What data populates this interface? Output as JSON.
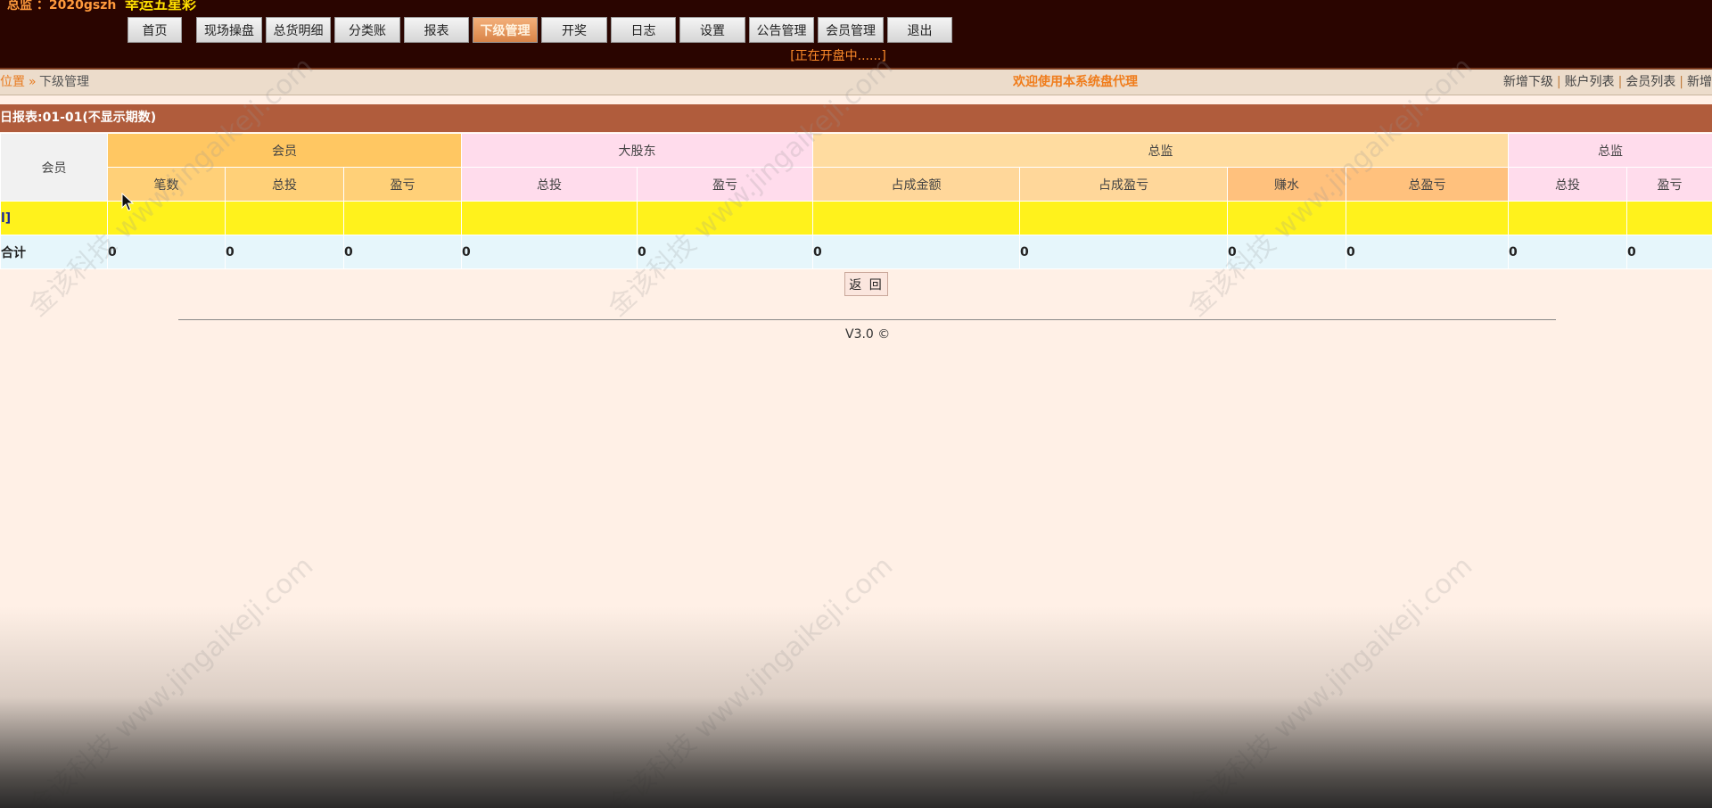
{
  "header": {
    "user_label": "总监 ：2020gszh",
    "site_name": "幸运五星彩",
    "status": "[正在开盘中......]",
    "nav": [
      {
        "label": "首页",
        "active": false
      },
      {
        "label": "现场操盘",
        "active": false
      },
      {
        "label": "总货明细",
        "active": false
      },
      {
        "label": "分类账",
        "active": false
      },
      {
        "label": "报表",
        "active": false
      },
      {
        "label": "下级管理",
        "active": true
      },
      {
        "label": "开奖",
        "active": false
      },
      {
        "label": "日志",
        "active": false
      },
      {
        "label": "设置",
        "active": false
      },
      {
        "label": "公告管理",
        "active": false
      },
      {
        "label": "会员管理",
        "active": false
      },
      {
        "label": "退出",
        "active": false
      }
    ]
  },
  "breadcrumb": {
    "position": "位置",
    "separator": "»",
    "current": "下级管理",
    "welcome": "欢迎使用本系统盘代理",
    "links": [
      "新增下级",
      "账户列表",
      "会员列表",
      "新增"
    ]
  },
  "report": {
    "title": "日报表:01-01(不显示期数)",
    "header_groups": {
      "member_col": "会员",
      "group_member": "会员",
      "group_shareholder": "大股东",
      "group_director": "总监",
      "group_director2": "总监"
    },
    "sub_headers": [
      "笔数",
      "总投",
      "盈亏",
      "总投",
      "盈亏",
      "占成金额",
      "占成盈亏",
      "赚水",
      "总盈亏",
      "总投",
      "盈亏"
    ],
    "yellow_row_label": "l]",
    "total_row": {
      "label": "合计",
      "values": [
        "0",
        "0",
        "0",
        "0",
        "0",
        "0",
        "0",
        "0",
        "0",
        "0",
        "0"
      ]
    }
  },
  "return_button": "返 回",
  "footer": {
    "version": "V3.0 ©"
  },
  "watermark_text": "金该科技 www.jingaikeji.com",
  "colors": {
    "header_bg": "#2a0500",
    "nav_active": "#d98448",
    "report_bar": "#b05c3c",
    "member_group": "#ffc762",
    "shareholder_group": "#ffdcec",
    "director_group": "#ffdca0",
    "yellow_row": "#fff21c",
    "total_row": "#e6f6fb",
    "page_bg": "#fff0e6"
  }
}
